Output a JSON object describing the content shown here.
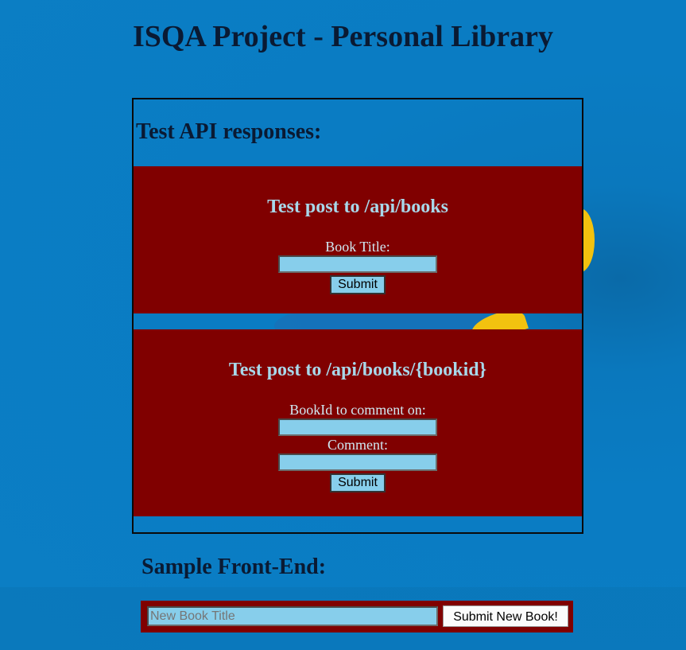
{
  "page": {
    "title": "ISQA Project - Personal Library"
  },
  "test_section": {
    "heading": "Test API responses:",
    "post_books": {
      "heading": "Test post to /api/books",
      "title_label": "Book Title:",
      "title_value": "",
      "submit_label": "Submit"
    },
    "post_book_comment": {
      "heading": "Test post to /api/books/{bookid}",
      "bookid_label": "BookId to comment on:",
      "bookid_value": "",
      "comment_label": "Comment:",
      "comment_value": "",
      "submit_label": "Submit"
    }
  },
  "front_end": {
    "heading": "Sample Front-End:",
    "new_book_placeholder": "New Book Title",
    "new_book_value": "",
    "submit_label": "Submit New Book!"
  },
  "colors": {
    "background": "#0b7ec4",
    "panel": "#800000",
    "input": "#87ceeb",
    "heading_text": "#0a1a33",
    "panel_text": "#a8d8ea"
  }
}
